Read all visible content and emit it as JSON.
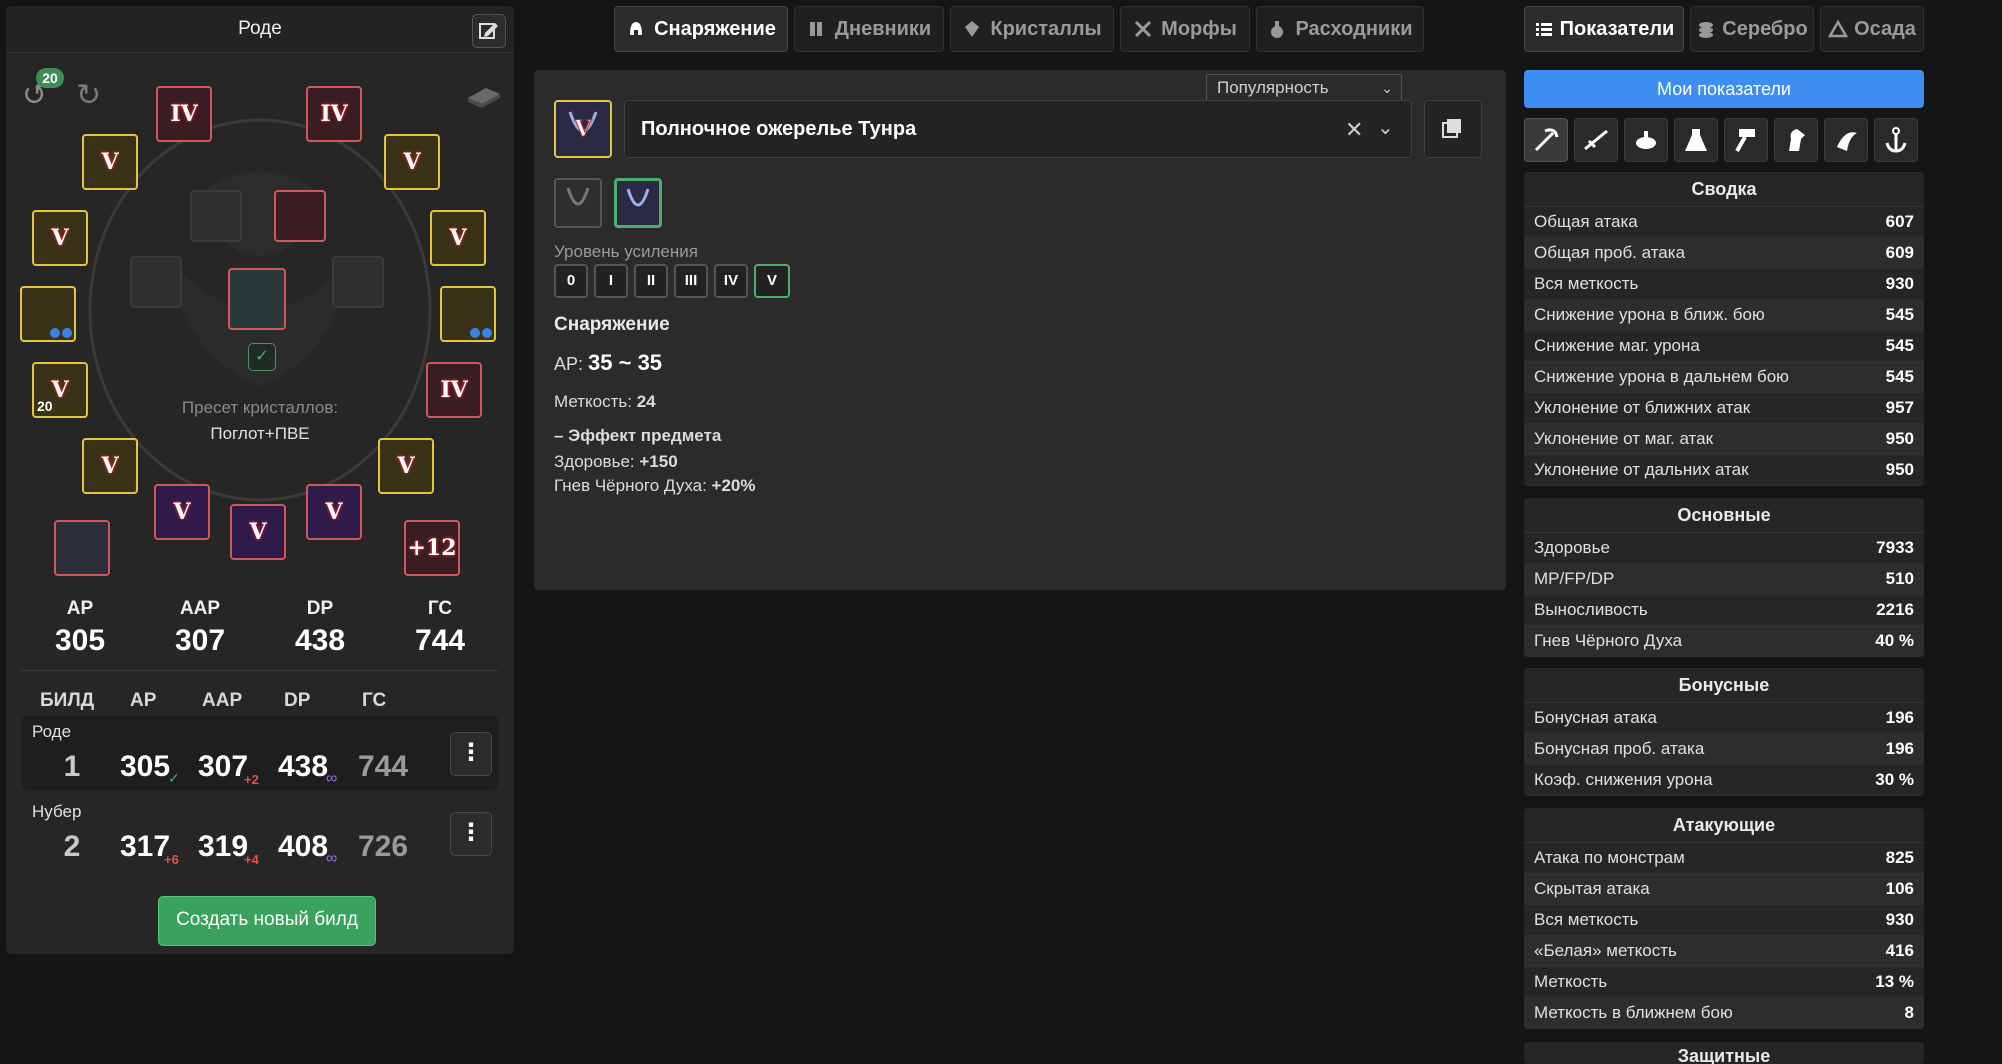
{
  "left": {
    "title": "Роде",
    "undo_count": "20",
    "slots": {
      "top_left": "IV",
      "top_right": "IV",
      "l2": "V",
      "r2": "V",
      "l3": "V",
      "r3": "V",
      "l4": "",
      "r4": "",
      "l5": "V",
      "r5": "IV",
      "l6": "V",
      "r6": "V",
      "b1": "V",
      "b2": "V",
      "b3": "V",
      "bottom_right": "+12",
      "l5_level": "20"
    },
    "crystal_preset_label": "Пресет кристаллов:",
    "crystal_preset_value": "Поглот+ПВЕ",
    "stats": [
      {
        "label": "AP",
        "value": "305"
      },
      {
        "label": "AAP",
        "value": "307"
      },
      {
        "label": "DP",
        "value": "438"
      },
      {
        "label": "ГС",
        "value": "744"
      }
    ],
    "build_columns": [
      "БИЛД",
      "AP",
      "AAP",
      "DP",
      "ГС"
    ],
    "builds": [
      {
        "name": "Роде",
        "num": "1",
        "ap": "305",
        "aap": "307",
        "aap_diff": "+2",
        "dp": "438",
        "gs": "744",
        "ap_mark": "✓",
        "dp_mark": "∞"
      },
      {
        "name": "Нубер",
        "num": "2",
        "ap": "317",
        "ap_diff": "+6",
        "aap": "319",
        "aap_diff": "+4",
        "dp": "408",
        "gs": "726",
        "dp_mark": "∞"
      }
    ],
    "create_build_label": "Создать новый билд"
  },
  "center": {
    "tabs": [
      "Снаряжение",
      "Дневники",
      "Кристаллы",
      "Морфы",
      "Расходники"
    ],
    "sort_value": "Популярность",
    "item_name": "Полночное ожерелье Тунра",
    "item_grade": "V",
    "enhance_label": "Уровень усиления",
    "enhance_levels": [
      "0",
      "I",
      "II",
      "III",
      "IV",
      "V"
    ],
    "gear_title": "Снаряжение",
    "ap_label": "AP:",
    "ap_value": "35 ~ 35",
    "accuracy_label": "Меткость:",
    "accuracy_value": "24",
    "effect_title": "– Эффект предмета",
    "hp_label": "Здоровье:",
    "hp_value": "+150",
    "rage_label": "Гнев Чёрного Духа:",
    "rage_value": "+20%"
  },
  "right": {
    "tabs": [
      "Показатели",
      "Серебро",
      "Осада"
    ],
    "my_stats_label": "Мои показатели",
    "cards": [
      {
        "title": "Сводка",
        "rows": [
          [
            "Общая атака",
            "607"
          ],
          [
            "Общая проб. атака",
            "609"
          ],
          [
            "Вся меткость",
            "930"
          ],
          [
            "Снижение урона в ближ. бою",
            "545"
          ],
          [
            "Снижение маг. урона",
            "545"
          ],
          [
            "Снижение урона в дальнем бою",
            "545"
          ],
          [
            "Уклонение от ближних атак",
            "957"
          ],
          [
            "Уклонение от маг. атак",
            "950"
          ],
          [
            "Уклонение от дальних атак",
            "950"
          ]
        ]
      },
      {
        "title": "Основные",
        "rows": [
          [
            "Здоровье",
            "7933"
          ],
          [
            "MP/FP/DP",
            "510"
          ],
          [
            "Выносливость",
            "2216"
          ],
          [
            "Гнев Чёрного Духа",
            "40 %"
          ]
        ]
      },
      {
        "title": "Бонусные",
        "rows": [
          [
            "Бонусная атака",
            "196"
          ],
          [
            "Бонусная проб. атака",
            "196"
          ],
          [
            "Коэф. снижения урона",
            "30 %"
          ]
        ]
      },
      {
        "title": "Атакующие",
        "rows": [
          [
            "Атака по монстрам",
            "825"
          ],
          [
            "Скрытая атака",
            "106"
          ],
          [
            "Вся меткость",
            "930"
          ],
          [
            "«Белая» меткость",
            "416"
          ],
          [
            "Меткость",
            "13 %"
          ],
          [
            "Меткость в ближнем бою",
            "8"
          ]
        ]
      },
      {
        "title": "Защитные",
        "rows": []
      }
    ]
  },
  "colors": {
    "background": "#151515",
    "panel": "#262626",
    "accent_blue": "#3d8ef0",
    "accent_green": "#39a35d",
    "grade_red": "#d0585d",
    "grade_gold": "#e2c640"
  }
}
